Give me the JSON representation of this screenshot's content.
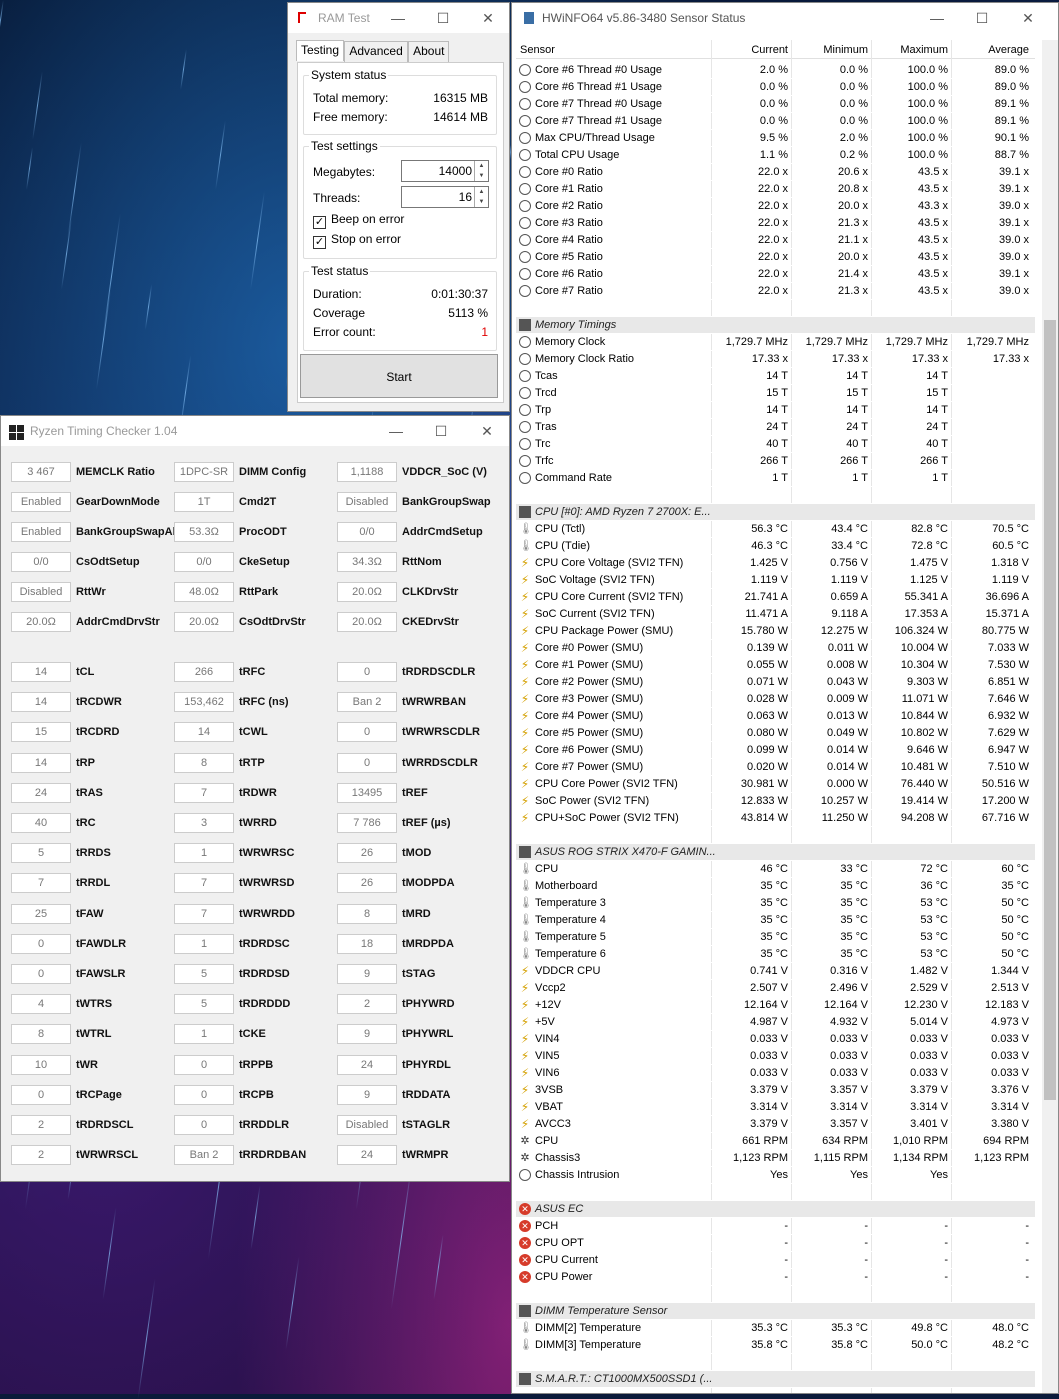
{
  "ram_test": {
    "title": "RAM Test",
    "tabs": [
      "Testing",
      "Advanced",
      "About"
    ],
    "system_status": {
      "label": "System status",
      "total_label": "Total memory:",
      "total": "16315 MB",
      "free_label": "Free memory:",
      "free": "14614 MB"
    },
    "test_settings": {
      "label": "Test settings",
      "mb_label": "Megabytes:",
      "mb": "14000",
      "threads_label": "Threads:",
      "threads": "16",
      "beep": "Beep on error",
      "stop": "Stop on error"
    },
    "test_status": {
      "label": "Test status",
      "duration_label": "Duration:",
      "duration": "0:01:30:37",
      "coverage_label": "Coverage",
      "coverage": "5113 %",
      "errors_label": "Error count:",
      "errors": "1"
    },
    "start": "Start"
  },
  "rtc": {
    "title": "Ryzen Timing Checker 1.04",
    "top": [
      [
        [
          "3 467",
          "MEMCLK Ratio"
        ],
        [
          "1DPC-SR",
          "DIMM Config"
        ],
        [
          "1,1188",
          "VDDCR_SoC (V)"
        ]
      ],
      [
        [
          "Enabled",
          "GearDownMode"
        ],
        [
          "1T",
          "Cmd2T"
        ],
        [
          "Disabled",
          "BankGroupSwap"
        ]
      ],
      [
        [
          "Enabled",
          "BankGroupSwapAlt"
        ],
        [
          "53.3Ω",
          "ProcODT"
        ],
        [
          "0/0",
          "AddrCmdSetup"
        ]
      ],
      [
        [
          "0/0",
          "CsOdtSetup"
        ],
        [
          "0/0",
          "CkeSetup"
        ],
        [
          "34.3Ω",
          "RttNom"
        ]
      ],
      [
        [
          "Disabled",
          "RttWr"
        ],
        [
          "48.0Ω",
          "RttPark"
        ],
        [
          "20.0Ω",
          "CLKDrvStr"
        ]
      ],
      [
        [
          "20.0Ω",
          "AddrCmdDrvStr"
        ],
        [
          "20.0Ω",
          "CsOdtDrvStr"
        ],
        [
          "20.0Ω",
          "CKEDrvStr"
        ]
      ]
    ],
    "timings": [
      [
        [
          "14",
          "tCL"
        ],
        [
          "266",
          "tRFC"
        ],
        [
          "0",
          "tRDRDSCDLR"
        ]
      ],
      [
        [
          "14",
          "tRCDWR"
        ],
        [
          "153,462",
          "tRFC (ns)"
        ],
        [
          "Ban 2",
          "tWRWRBAN"
        ]
      ],
      [
        [
          "15",
          "tRCDRD"
        ],
        [
          "14",
          "tCWL"
        ],
        [
          "0",
          "tWRWRSCDLR"
        ]
      ],
      [
        [
          "14",
          "tRP"
        ],
        [
          "8",
          "tRTP"
        ],
        [
          "0",
          "tWRRDSCDLR"
        ]
      ],
      [
        [
          "24",
          "tRAS"
        ],
        [
          "7",
          "tRDWR"
        ],
        [
          "13495",
          "tREF"
        ]
      ],
      [
        [
          "40",
          "tRC"
        ],
        [
          "3",
          "tWRRD"
        ],
        [
          "7 786",
          "tREF (µs)"
        ]
      ],
      [
        [
          "5",
          "tRRDS"
        ],
        [
          "1",
          "tWRWRSC"
        ],
        [
          "26",
          "tMOD"
        ]
      ],
      [
        [
          "7",
          "tRRDL"
        ],
        [
          "7",
          "tWRWRSD"
        ],
        [
          "26",
          "tMODPDA"
        ]
      ],
      [
        [
          "25",
          "tFAW"
        ],
        [
          "7",
          "tWRWRDD"
        ],
        [
          "8",
          "tMRD"
        ]
      ],
      [
        [
          "0",
          "tFAWDLR"
        ],
        [
          "1",
          "tRDRDSC"
        ],
        [
          "18",
          "tMRDPDA"
        ]
      ],
      [
        [
          "0",
          "tFAWSLR"
        ],
        [
          "5",
          "tRDRDSD"
        ],
        [
          "9",
          "tSTAG"
        ]
      ],
      [
        [
          "4",
          "tWTRS"
        ],
        [
          "5",
          "tRDRDDD"
        ],
        [
          "2",
          "tPHYWRD"
        ]
      ],
      [
        [
          "8",
          "tWTRL"
        ],
        [
          "1",
          "tCKE"
        ],
        [
          "9",
          "tPHYWRL"
        ]
      ],
      [
        [
          "10",
          "tWR"
        ],
        [
          "0",
          "tRPPB"
        ],
        [
          "24",
          "tPHYRDL"
        ]
      ],
      [
        [
          "0",
          "tRCPage"
        ],
        [
          "0",
          "tRCPB"
        ],
        [
          "9",
          "tRDDATA"
        ]
      ],
      [
        [
          "2",
          "tRDRDSCL"
        ],
        [
          "0",
          "tRRDDLR"
        ],
        [
          "Disabled",
          "tSTAGLR"
        ]
      ],
      [
        [
          "2",
          "tWRWRSCL"
        ],
        [
          "Ban 2",
          "tRRDRDBAN"
        ],
        [
          "24",
          "tWRMPR"
        ]
      ]
    ]
  },
  "hwinfo": {
    "title": "HWiNFO64 v5.86-3480 Sensor Status",
    "columns": [
      "Sensor",
      "Current",
      "Minimum",
      "Maximum",
      "Average"
    ],
    "rows": [
      [
        "circ",
        "Core #6 Thread #0 Usage",
        "2.0 %",
        "0.0 %",
        "100.0 %",
        "89.0 %"
      ],
      [
        "circ",
        "Core #6 Thread #1 Usage",
        "0.0 %",
        "0.0 %",
        "100.0 %",
        "89.0 %"
      ],
      [
        "circ",
        "Core #7 Thread #0 Usage",
        "0.0 %",
        "0.0 %",
        "100.0 %",
        "89.1 %"
      ],
      [
        "circ",
        "Core #7 Thread #1 Usage",
        "0.0 %",
        "0.0 %",
        "100.0 %",
        "89.1 %"
      ],
      [
        "circ",
        "Max CPU/Thread Usage",
        "9.5 %",
        "2.0 %",
        "100.0 %",
        "90.1 %"
      ],
      [
        "circ",
        "Total CPU Usage",
        "1.1 %",
        "0.2 %",
        "100.0 %",
        "88.7 %"
      ],
      [
        "circ",
        "Core #0 Ratio",
        "22.0 x",
        "20.6 x",
        "43.5 x",
        "39.1 x"
      ],
      [
        "circ",
        "Core #1 Ratio",
        "22.0 x",
        "20.8 x",
        "43.5 x",
        "39.1 x"
      ],
      [
        "circ",
        "Core #2 Ratio",
        "22.0 x",
        "20.0 x",
        "43.3 x",
        "39.0 x"
      ],
      [
        "circ",
        "Core #3 Ratio",
        "22.0 x",
        "21.3 x",
        "43.5 x",
        "39.1 x"
      ],
      [
        "circ",
        "Core #4 Ratio",
        "22.0 x",
        "21.1 x",
        "43.5 x",
        "39.0 x"
      ],
      [
        "circ",
        "Core #5 Ratio",
        "22.0 x",
        "20.0 x",
        "43.5 x",
        "39.0 x"
      ],
      [
        "circ",
        "Core #6 Ratio",
        "22.0 x",
        "21.4 x",
        "43.5 x",
        "39.1 x"
      ],
      [
        "circ",
        "Core #7 Ratio",
        "22.0 x",
        "21.3 x",
        "43.5 x",
        "39.0 x"
      ],
      [
        "blank",
        "",
        "",
        "",
        "",
        ""
      ],
      [
        "hdr",
        "Memory Timings",
        "",
        "",
        "",
        ""
      ],
      [
        "circ",
        "Memory Clock",
        "1,729.7 MHz",
        "1,729.7 MHz",
        "1,729.7 MHz",
        "1,729.7 MHz"
      ],
      [
        "circ",
        "Memory Clock Ratio",
        "17.33 x",
        "17.33 x",
        "17.33 x",
        "17.33 x"
      ],
      [
        "circ",
        "Tcas",
        "14 T",
        "14 T",
        "14 T",
        ""
      ],
      [
        "circ",
        "Trcd",
        "15 T",
        "15 T",
        "15 T",
        ""
      ],
      [
        "circ",
        "Trp",
        "14 T",
        "14 T",
        "14 T",
        ""
      ],
      [
        "circ",
        "Tras",
        "24 T",
        "24 T",
        "24 T",
        ""
      ],
      [
        "circ",
        "Trc",
        "40 T",
        "40 T",
        "40 T",
        ""
      ],
      [
        "circ",
        "Trfc",
        "266 T",
        "266 T",
        "266 T",
        ""
      ],
      [
        "circ",
        "Command Rate",
        "1 T",
        "1 T",
        "1 T",
        ""
      ],
      [
        "blank",
        "",
        "",
        "",
        "",
        ""
      ],
      [
        "hdr",
        "CPU [#0]: AMD Ryzen 7 2700X: E...",
        "",
        "",
        "",
        ""
      ],
      [
        "therm",
        "CPU (Tctl)",
        "56.3 °C",
        "43.4 °C",
        "82.8 °C",
        "70.5 °C"
      ],
      [
        "therm",
        "CPU (Tdie)",
        "46.3 °C",
        "33.4 °C",
        "72.8 °C",
        "60.5 °C"
      ],
      [
        "bolt",
        "CPU Core Voltage (SVI2 TFN)",
        "1.425 V",
        "0.756 V",
        "1.475 V",
        "1.318 V"
      ],
      [
        "bolt",
        "SoC Voltage (SVI2 TFN)",
        "1.119 V",
        "1.119 V",
        "1.125 V",
        "1.119 V"
      ],
      [
        "bolt",
        "CPU Core Current (SVI2 TFN)",
        "21.741 A",
        "0.659 A",
        "55.341 A",
        "36.696 A"
      ],
      [
        "bolt",
        "SoC Current (SVI2 TFN)",
        "11.471 A",
        "9.118 A",
        "17.353 A",
        "15.371 A"
      ],
      [
        "bolt",
        "CPU Package Power (SMU)",
        "15.780 W",
        "12.275 W",
        "106.324 W",
        "80.775 W"
      ],
      [
        "bolt",
        "Core #0 Power (SMU)",
        "0.139 W",
        "0.011 W",
        "10.004 W",
        "7.033 W"
      ],
      [
        "bolt",
        "Core #1 Power (SMU)",
        "0.055 W",
        "0.008 W",
        "10.304 W",
        "7.530 W"
      ],
      [
        "bolt",
        "Core #2 Power (SMU)",
        "0.071 W",
        "0.043 W",
        "9.303 W",
        "6.851 W"
      ],
      [
        "bolt",
        "Core #3 Power (SMU)",
        "0.028 W",
        "0.009 W",
        "11.071 W",
        "7.646 W"
      ],
      [
        "bolt",
        "Core #4 Power (SMU)",
        "0.063 W",
        "0.013 W",
        "10.844 W",
        "6.932 W"
      ],
      [
        "bolt",
        "Core #5 Power (SMU)",
        "0.080 W",
        "0.049 W",
        "10.802 W",
        "7.629 W"
      ],
      [
        "bolt",
        "Core #6 Power (SMU)",
        "0.099 W",
        "0.014 W",
        "9.646 W",
        "6.947 W"
      ],
      [
        "bolt",
        "Core #7 Power (SMU)",
        "0.020 W",
        "0.014 W",
        "10.481 W",
        "7.510 W"
      ],
      [
        "bolt",
        "CPU Core Power (SVI2 TFN)",
        "30.981 W",
        "0.000 W",
        "76.440 W",
        "50.516 W"
      ],
      [
        "bolt",
        "SoC Power (SVI2 TFN)",
        "12.833 W",
        "10.257 W",
        "19.414 W",
        "17.200 W"
      ],
      [
        "bolt",
        "CPU+SoC Power (SVI2 TFN)",
        "43.814 W",
        "11.250 W",
        "94.208 W",
        "67.716 W"
      ],
      [
        "blank",
        "",
        "",
        "",
        "",
        ""
      ],
      [
        "hdr",
        "ASUS ROG STRIX X470-F GAMIN...",
        "",
        "",
        "",
        ""
      ],
      [
        "therm",
        "CPU",
        "46 °C",
        "33 °C",
        "72 °C",
        "60 °C"
      ],
      [
        "therm",
        "Motherboard",
        "35 °C",
        "35 °C",
        "36 °C",
        "35 °C"
      ],
      [
        "therm",
        "Temperature 3",
        "35 °C",
        "35 °C",
        "53 °C",
        "50 °C"
      ],
      [
        "therm",
        "Temperature 4",
        "35 °C",
        "35 °C",
        "53 °C",
        "50 °C"
      ],
      [
        "therm",
        "Temperature 5",
        "35 °C",
        "35 °C",
        "53 °C",
        "50 °C"
      ],
      [
        "therm",
        "Temperature 6",
        "35 °C",
        "35 °C",
        "53 °C",
        "50 °C"
      ],
      [
        "bolt",
        "VDDCR CPU",
        "0.741 V",
        "0.316 V",
        "1.482 V",
        "1.344 V"
      ],
      [
        "bolt",
        "Vccp2",
        "2.507 V",
        "2.496 V",
        "2.529 V",
        "2.513 V"
      ],
      [
        "bolt",
        "+12V",
        "12.164 V",
        "12.164 V",
        "12.230 V",
        "12.183 V"
      ],
      [
        "bolt",
        "+5V",
        "4.987 V",
        "4.932 V",
        "5.014 V",
        "4.973 V"
      ],
      [
        "bolt",
        "VIN4",
        "0.033 V",
        "0.033 V",
        "0.033 V",
        "0.033 V"
      ],
      [
        "bolt",
        "VIN5",
        "0.033 V",
        "0.033 V",
        "0.033 V",
        "0.033 V"
      ],
      [
        "bolt",
        "VIN6",
        "0.033 V",
        "0.033 V",
        "0.033 V",
        "0.033 V"
      ],
      [
        "bolt",
        "3VSB",
        "3.379 V",
        "3.357 V",
        "3.379 V",
        "3.376 V"
      ],
      [
        "bolt",
        "VBAT",
        "3.314 V",
        "3.314 V",
        "3.314 V",
        "3.314 V"
      ],
      [
        "bolt",
        "AVCC3",
        "3.379 V",
        "3.357 V",
        "3.401 V",
        "3.380 V"
      ],
      [
        "fan",
        "CPU",
        "661 RPM",
        "634 RPM",
        "1,010 RPM",
        "694 RPM"
      ],
      [
        "fan",
        "Chassis3",
        "1,123 RPM",
        "1,115 RPM",
        "1,134 RPM",
        "1,123 RPM"
      ],
      [
        "circ",
        "Chassis Intrusion",
        "Yes",
        "Yes",
        "Yes",
        ""
      ],
      [
        "blank",
        "",
        "",
        "",
        "",
        ""
      ],
      [
        "hdrx",
        "ASUS EC",
        "",
        "",
        "",
        ""
      ],
      [
        "x",
        "PCH",
        "-",
        "-",
        "-",
        "-"
      ],
      [
        "x",
        "CPU OPT",
        "-",
        "-",
        "-",
        "-"
      ],
      [
        "x",
        "CPU Current",
        "-",
        "-",
        "-",
        "-"
      ],
      [
        "x",
        "CPU Power",
        "-",
        "-",
        "-",
        "-"
      ],
      [
        "blank",
        "",
        "",
        "",
        "",
        ""
      ],
      [
        "hdr",
        "DIMM Temperature Sensor",
        "",
        "",
        "",
        ""
      ],
      [
        "therm",
        "DIMM[2] Temperature",
        "35.3 °C",
        "35.3 °C",
        "49.8 °C",
        "48.0 °C"
      ],
      [
        "therm",
        "DIMM[3] Temperature",
        "35.8 °C",
        "35.8 °C",
        "50.0 °C",
        "48.2 °C"
      ],
      [
        "blank",
        "",
        "",
        "",
        "",
        ""
      ],
      [
        "hdr",
        "S.M.A.R.T.: CT1000MX500SSD1 (...",
        "",
        "",
        "",
        ""
      ]
    ]
  }
}
